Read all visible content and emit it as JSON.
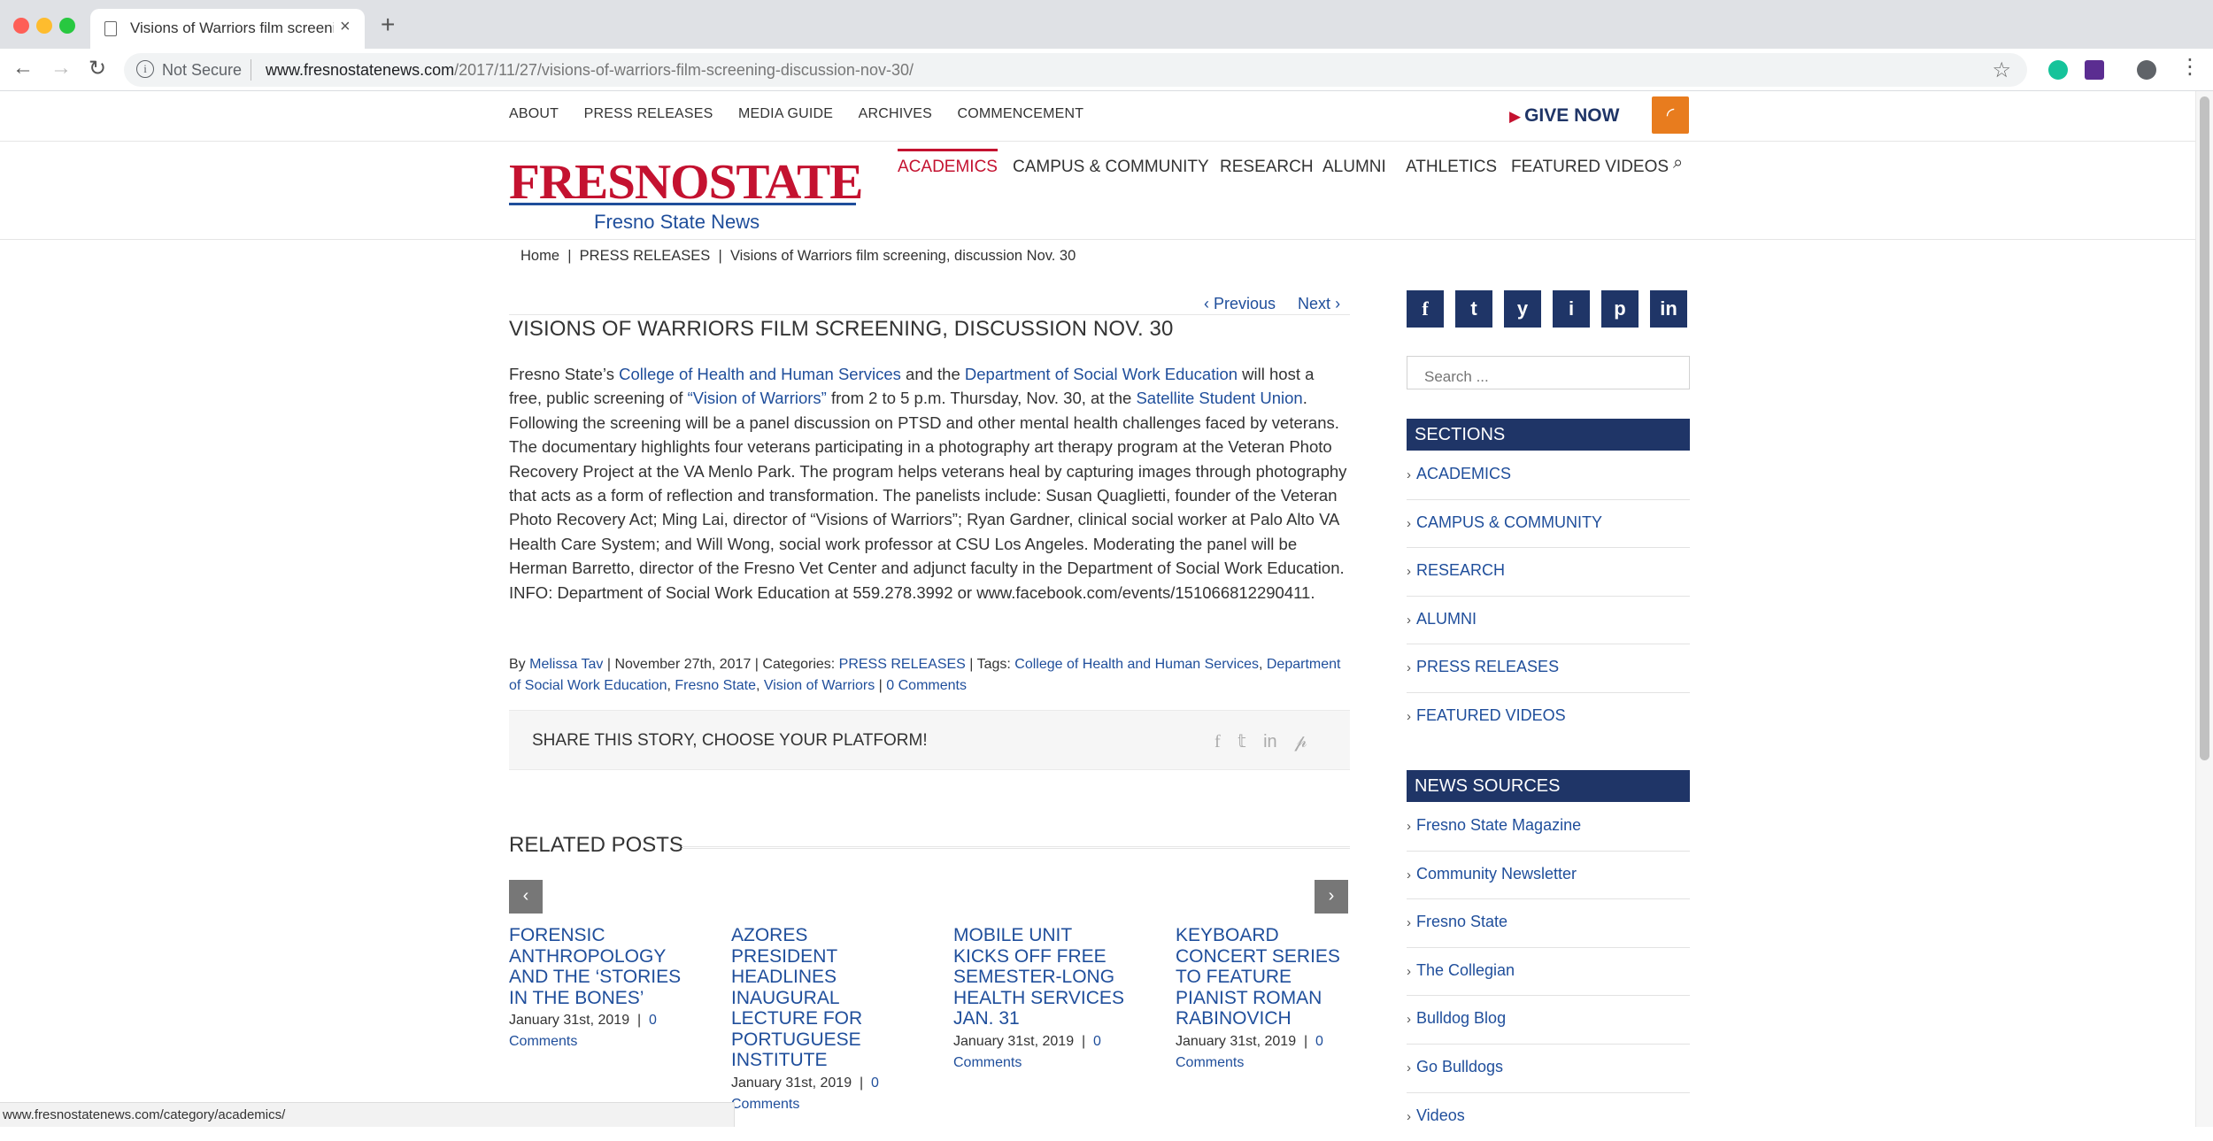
{
  "browser": {
    "tab_title": "Visions of Warriors film screening, discussion Nov. 30",
    "tab_close": "×",
    "new_tab": "+",
    "security_label": "Not Secure",
    "url_host": "www.fresnostatenews.com",
    "url_path": "/2017/11/27/visions-of-warriors-film-screening-discussion-nov-30/"
  },
  "site": {
    "top_nav": [
      "ABOUT",
      "PRESS RELEASES",
      "MEDIA GUIDE",
      "ARCHIVES",
      "COMMENCEMENT"
    ],
    "give_now": "GIVE NOW",
    "logo_text": "FRESNOSTATE",
    "logo_sub": "Fresno State News",
    "main_nav": [
      "ACADEMICS",
      "CAMPUS & COMMUNITY",
      "RESEARCH",
      "ALUMNI",
      "ATHLETICS",
      "FEATURED VIDEOS"
    ],
    "active_nav": "ACADEMICS"
  },
  "breadcrumb": {
    "home": "Home",
    "sep": "|",
    "category": "PRESS RELEASES",
    "current": "Visions of Warriors film screening, discussion Nov. 30"
  },
  "pager": {
    "previous": "Previous",
    "next": "Next"
  },
  "article": {
    "title": "VISIONS OF WARRIORS FILM SCREENING, DISCUSSION NOV. 30",
    "p1": "Fresno State’s ",
    "link_chhs": "College of Health and Human Services",
    "p2": " and the ",
    "link_swe": "Department of Social Work Education",
    "p3": " will host a free, public screening of ",
    "link_film": "“Vision of Warriors”",
    "p4": " from ",
    "time_bold": "2 to 5 p.m. Thursday, Nov. 30,",
    "p5": " at the ",
    "link_ssu": "Satellite Student Union",
    "p6": ". Following the screening will be a panel discussion on PTSD and other mental health challenges faced by veterans. The documentary highlights four veterans participating in a photography art therapy program at the Veteran Photo Recovery Project at the VA Menlo Park. The program helps veterans heal by capturing images through photography that acts as a form of reflection and transformation. The panelists include: Susan Quaglietti, founder of the Veteran Photo Recovery Act; Ming Lai, director of “Visions of Warriors”; Ryan Gardner, clinical social worker at Palo Alto VA Health Care System; and Will Wong, social work professor at CSU Los Angeles. Moderating the panel will be Herman Barretto, director of the Fresno Vet Center and adjunct faculty in the Department of Social Work Education. INFO: Department of Social Work Education at 559.278.3992 or www.facebook.com/events/151066812290411."
  },
  "meta": {
    "by": "By ",
    "author": "Melissa Tav",
    "date": " | November 27th, 2017 | Categories: ",
    "category": "PRESS RELEASES",
    "tags_label": " | Tags: ",
    "tag1": "College of Health and Human Services",
    "tag2": "Department of Social Work Education",
    "tag3": "Fresno State",
    "tag4": "Vision of Warriors",
    "comma": ", ",
    "comments_sep": " | ",
    "comments": "0 Comments"
  },
  "share": {
    "label": "SHARE THIS STORY, CHOOSE YOUR PLATFORM!"
  },
  "related": {
    "heading": "RELATED POSTS",
    "prev": "‹",
    "next": "›",
    "posts": [
      {
        "title": "FORENSIC ANTHROPOLOGY AND THE ‘STORIES IN THE BONES’",
        "date": "January 31st, 2019",
        "comments": "0 Comments"
      },
      {
        "title": "AZORES PRESIDENT HEADLINES INAUGURAL LECTURE FOR PORTUGUESE INSTITUTE",
        "date": "January 31st, 2019",
        "comments": "0 Comments"
      },
      {
        "title": "MOBILE UNIT KICKS OFF FREE SEMESTER-LONG HEALTH SERVICES JAN. 31",
        "date": "January 31st, 2019",
        "comments": "0 Comments"
      },
      {
        "title": "KEYBOARD CONCERT SERIES TO FEATURE PIANIST ROMAN RABINOVICH",
        "date": "January 31st, 2019",
        "comments": "0 Comments"
      }
    ]
  },
  "sidebar": {
    "social": [
      "f",
      "t",
      "y",
      "i",
      "p",
      "in"
    ],
    "search_placeholder": "Search ...",
    "sections_heading": "SECTIONS",
    "sections": [
      "ACADEMICS",
      "CAMPUS & COMMUNITY",
      "RESEARCH",
      "ALUMNI",
      "PRESS RELEASES",
      "FEATURED VIDEOS"
    ],
    "news_heading": "NEWS SOURCES",
    "news": [
      "Fresno State Magazine",
      "Community Newsletter",
      "Fresno State",
      "The Collegian",
      "Bulldog Blog",
      "Go Bulldogs",
      "Videos"
    ]
  },
  "status_bar": "www.fresnostatenews.com/category/academics/",
  "colors": {
    "brand_red": "#c41230",
    "brand_blue": "#1f3567",
    "link_blue": "#1f4e9b",
    "rss_orange": "#e87c1e"
  }
}
